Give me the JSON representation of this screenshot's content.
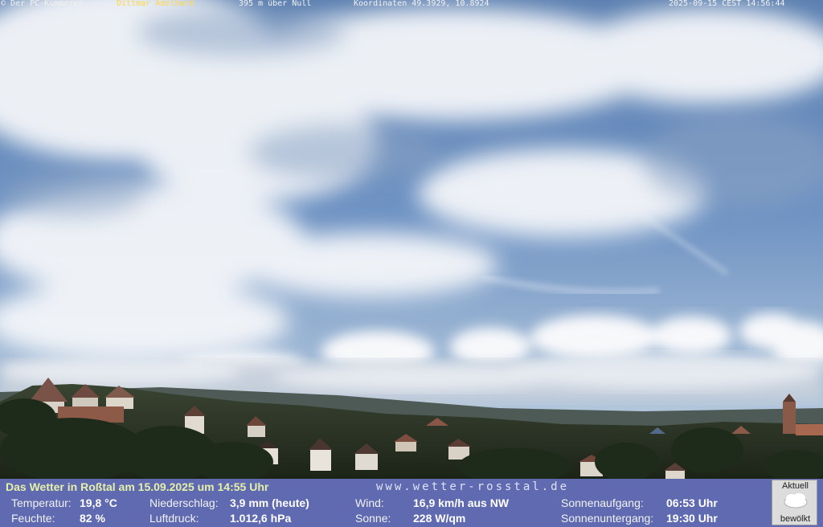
{
  "overlay": {
    "copyright": "© Der PC-Kümmerer Dittmar Adelhard",
    "copyright_prefix": "© Der PC-Kümmerer ",
    "copyright_name": "Dittmar Adelhard",
    "altitude": "395 m über Null",
    "coordinates": "Koordinaten 49.3929, 10.8924",
    "timestamp": "2025-09-15 CEST 14:56:44"
  },
  "panel": {
    "title": "Das Wetter in Roßtal am 15.09.2025 um 14:55 Uhr",
    "url": "www.wetter-rosstal.de",
    "readings": [
      {
        "label": "Temperatur:",
        "value": "19,8 °C"
      },
      {
        "label": "Feuchte:",
        "value": "82 %"
      },
      {
        "label": "Niederschlag:",
        "value": "3,9 mm (heute)"
      },
      {
        "label": "Luftdruck:",
        "value": "1.012,6 hPa"
      },
      {
        "label": "Wind:",
        "value": "16,9 km/h aus NW"
      },
      {
        "label": "Sonne:",
        "value": "228 W/qm"
      },
      {
        "label": "Sonnenaufgang:",
        "value": "06:53 Uhr"
      },
      {
        "label": "Sonnenuntergang:",
        "value": "19:30 Uhr"
      }
    ],
    "current": {
      "header": "Aktuell",
      "condition": "bewölkt",
      "icon": "cloud-icon"
    }
  },
  "colors": {
    "panel_bg": "#5f6ab0",
    "title_text": "#e6f0a8",
    "overlay_highlight": "#ffd84a"
  }
}
